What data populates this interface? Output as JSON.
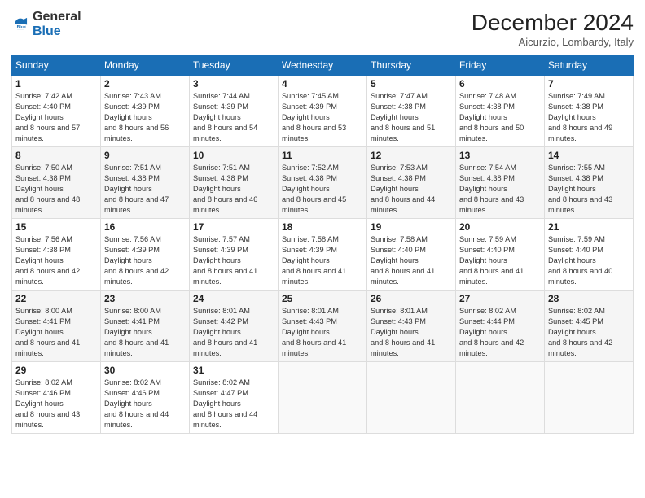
{
  "logo": {
    "general": "General",
    "blue": "Blue"
  },
  "header": {
    "month": "December 2024",
    "location": "Aicurzio, Lombardy, Italy"
  },
  "weekdays": [
    "Sunday",
    "Monday",
    "Tuesday",
    "Wednesday",
    "Thursday",
    "Friday",
    "Saturday"
  ],
  "weeks": [
    [
      {
        "day": "1",
        "sunrise": "7:42 AM",
        "sunset": "4:40 PM",
        "daylight": "8 hours and 57 minutes."
      },
      {
        "day": "2",
        "sunrise": "7:43 AM",
        "sunset": "4:39 PM",
        "daylight": "8 hours and 56 minutes."
      },
      {
        "day": "3",
        "sunrise": "7:44 AM",
        "sunset": "4:39 PM",
        "daylight": "8 hours and 54 minutes."
      },
      {
        "day": "4",
        "sunrise": "7:45 AM",
        "sunset": "4:39 PM",
        "daylight": "8 hours and 53 minutes."
      },
      {
        "day": "5",
        "sunrise": "7:47 AM",
        "sunset": "4:38 PM",
        "daylight": "8 hours and 51 minutes."
      },
      {
        "day": "6",
        "sunrise": "7:48 AM",
        "sunset": "4:38 PM",
        "daylight": "8 hours and 50 minutes."
      },
      {
        "day": "7",
        "sunrise": "7:49 AM",
        "sunset": "4:38 PM",
        "daylight": "8 hours and 49 minutes."
      }
    ],
    [
      {
        "day": "8",
        "sunrise": "7:50 AM",
        "sunset": "4:38 PM",
        "daylight": "8 hours and 48 minutes."
      },
      {
        "day": "9",
        "sunrise": "7:51 AM",
        "sunset": "4:38 PM",
        "daylight": "8 hours and 47 minutes."
      },
      {
        "day": "10",
        "sunrise": "7:51 AM",
        "sunset": "4:38 PM",
        "daylight": "8 hours and 46 minutes."
      },
      {
        "day": "11",
        "sunrise": "7:52 AM",
        "sunset": "4:38 PM",
        "daylight": "8 hours and 45 minutes."
      },
      {
        "day": "12",
        "sunrise": "7:53 AM",
        "sunset": "4:38 PM",
        "daylight": "8 hours and 44 minutes."
      },
      {
        "day": "13",
        "sunrise": "7:54 AM",
        "sunset": "4:38 PM",
        "daylight": "8 hours and 43 minutes."
      },
      {
        "day": "14",
        "sunrise": "7:55 AM",
        "sunset": "4:38 PM",
        "daylight": "8 hours and 43 minutes."
      }
    ],
    [
      {
        "day": "15",
        "sunrise": "7:56 AM",
        "sunset": "4:38 PM",
        "daylight": "8 hours and 42 minutes."
      },
      {
        "day": "16",
        "sunrise": "7:56 AM",
        "sunset": "4:39 PM",
        "daylight": "8 hours and 42 minutes."
      },
      {
        "day": "17",
        "sunrise": "7:57 AM",
        "sunset": "4:39 PM",
        "daylight": "8 hours and 41 minutes."
      },
      {
        "day": "18",
        "sunrise": "7:58 AM",
        "sunset": "4:39 PM",
        "daylight": "8 hours and 41 minutes."
      },
      {
        "day": "19",
        "sunrise": "7:58 AM",
        "sunset": "4:40 PM",
        "daylight": "8 hours and 41 minutes."
      },
      {
        "day": "20",
        "sunrise": "7:59 AM",
        "sunset": "4:40 PM",
        "daylight": "8 hours and 41 minutes."
      },
      {
        "day": "21",
        "sunrise": "7:59 AM",
        "sunset": "4:40 PM",
        "daylight": "8 hours and 40 minutes."
      }
    ],
    [
      {
        "day": "22",
        "sunrise": "8:00 AM",
        "sunset": "4:41 PM",
        "daylight": "8 hours and 41 minutes."
      },
      {
        "day": "23",
        "sunrise": "8:00 AM",
        "sunset": "4:41 PM",
        "daylight": "8 hours and 41 minutes."
      },
      {
        "day": "24",
        "sunrise": "8:01 AM",
        "sunset": "4:42 PM",
        "daylight": "8 hours and 41 minutes."
      },
      {
        "day": "25",
        "sunrise": "8:01 AM",
        "sunset": "4:43 PM",
        "daylight": "8 hours and 41 minutes."
      },
      {
        "day": "26",
        "sunrise": "8:01 AM",
        "sunset": "4:43 PM",
        "daylight": "8 hours and 41 minutes."
      },
      {
        "day": "27",
        "sunrise": "8:02 AM",
        "sunset": "4:44 PM",
        "daylight": "8 hours and 42 minutes."
      },
      {
        "day": "28",
        "sunrise": "8:02 AM",
        "sunset": "4:45 PM",
        "daylight": "8 hours and 42 minutes."
      }
    ],
    [
      {
        "day": "29",
        "sunrise": "8:02 AM",
        "sunset": "4:46 PM",
        "daylight": "8 hours and 43 minutes."
      },
      {
        "day": "30",
        "sunrise": "8:02 AM",
        "sunset": "4:46 PM",
        "daylight": "8 hours and 44 minutes."
      },
      {
        "day": "31",
        "sunrise": "8:02 AM",
        "sunset": "4:47 PM",
        "daylight": "8 hours and 44 minutes."
      },
      null,
      null,
      null,
      null
    ]
  ]
}
